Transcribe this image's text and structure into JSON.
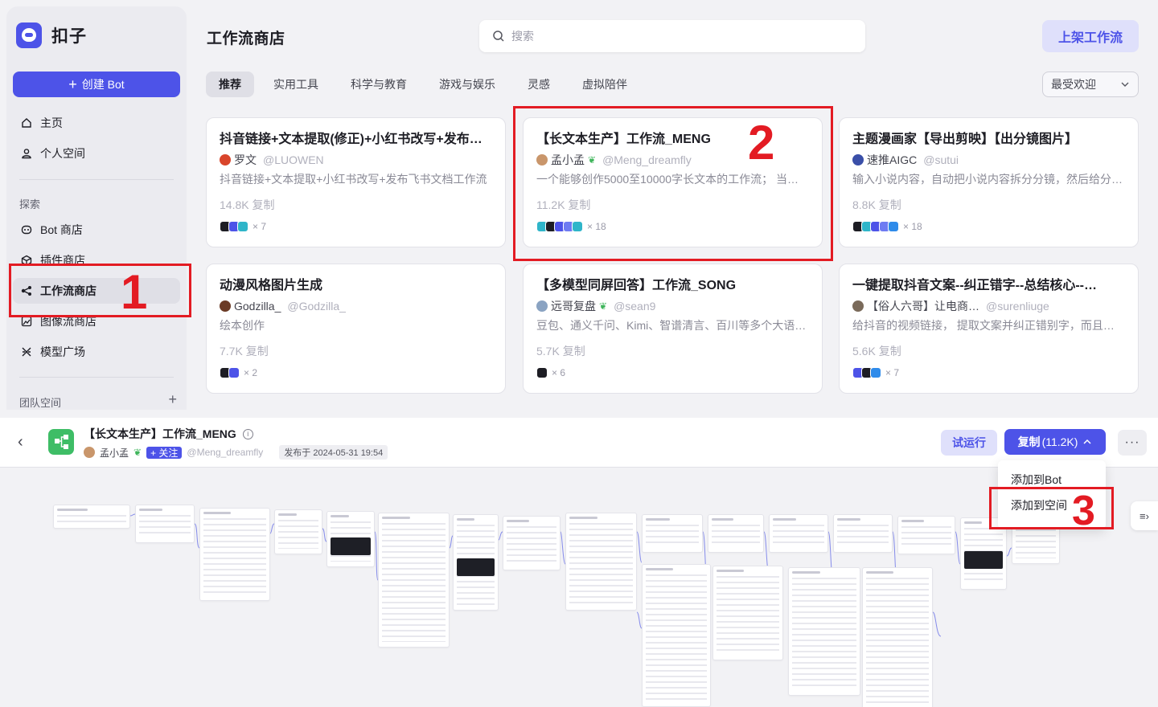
{
  "brand": {
    "name": "扣子"
  },
  "sidebar": {
    "create_label": "创建 Bot",
    "top_items": [
      {
        "label": "主页",
        "icon": "home-icon"
      },
      {
        "label": "个人空间",
        "icon": "user-icon"
      }
    ],
    "explore_title": "探索",
    "explore_items": [
      {
        "label": "Bot 商店",
        "icon": "bot-icon"
      },
      {
        "label": "插件商店",
        "icon": "cube-icon"
      },
      {
        "label": "工作流商店",
        "icon": "workflow-icon",
        "active": true
      },
      {
        "label": "图像流商店",
        "icon": "image-flow-icon"
      },
      {
        "label": "模型广场",
        "icon": "model-icon"
      }
    ],
    "team_title": "团队空间"
  },
  "header": {
    "title": "工作流商店",
    "search_placeholder": "搜索",
    "publish_label": "上架工作流"
  },
  "tabs": [
    "推荐",
    "实用工具",
    "科学与教育",
    "游戏与娱乐",
    "灵感",
    "虚拟陪伴"
  ],
  "sort": {
    "selected": "最受欢迎"
  },
  "cards": [
    {
      "title": "抖音链接+文本提取(修正)+小红书改写+发布…",
      "author": "罗文",
      "handle": "@LUOWEN",
      "desc": "抖音链接+文本提取+小红书改写+发布飞书文档工作流",
      "copies": "14.8K 复制",
      "plugins": "× 7",
      "avatar_color": "#d9452b",
      "plugin_colors": [
        "#1d1d24",
        "#4d53e8",
        "#2fb5c9"
      ],
      "verified": false
    },
    {
      "title": "【长文本生产】工作流_MENG",
      "author": "孟小孟",
      "handle": "@Meng_dreamfly",
      "desc": "一个能够创作5000至10000字长文本的工作流；  当…",
      "copies": "11.2K 复制",
      "plugins": "× 18",
      "avatar_color": "#c9966b",
      "plugin_colors": [
        "#2fb5c9",
        "#1d1d24",
        "#4d53e8",
        "#6e7bf2",
        "#2fb5c9"
      ],
      "verified": true
    },
    {
      "title": "主题漫画家【导出剪映】【出分镜图片】",
      "author": "速推AIGC",
      "handle": "@sutui",
      "desc": "输入小说内容，自动把小说内容拆分分镜，然后给分…",
      "copies": "8.8K 复制",
      "plugins": "× 18",
      "avatar_color": "#3a4fa8",
      "plugin_colors": [
        "#1d1d24",
        "#2fb5c9",
        "#4d53e8",
        "#6e7bf2",
        "#2f8bea"
      ],
      "verified": false
    },
    {
      "title": "动漫风格图片生成",
      "author": "Godzilla_",
      "handle": "@Godzilla_",
      "desc": "绘本创作",
      "copies": "7.7K 复制",
      "plugins": "× 2",
      "avatar_color": "#6b3b26",
      "plugin_colors": [
        "#1d1d24",
        "#4d53e8"
      ],
      "verified": false
    },
    {
      "title": "【多模型同屏回答】工作流_SONG",
      "author": "远哥复盘",
      "handle": "@sean9",
      "desc": "豆包、通义千问、Kimi、智谱清言、百川等多个大语…",
      "copies": "5.7K 复制",
      "plugins": "× 6",
      "avatar_color": "#8aa3c2",
      "plugin_colors": [
        "#1d1d24"
      ],
      "verified": true
    },
    {
      "title": "一键提取抖音文案--纠正错字--总结核心--…",
      "author": "【俗人六哥】让电商…",
      "handle": "@surenliuge",
      "desc": "给抖音的视频链接， 提取文案并纠正错别字，而且…",
      "copies": "5.6K 复制",
      "plugins": "× 7",
      "avatar_color": "#7a6a5a",
      "plugin_colors": [
        "#4d53e8",
        "#1d1d24",
        "#2f8bea"
      ],
      "verified": false
    }
  ],
  "detail": {
    "title": "【长文本生产】工作流_MENG",
    "author": "孟小孟",
    "follow_label": "+ 关注",
    "handle": "@Meng_dreamfly",
    "published": "发布于 2024-05-31 19:54",
    "trial_label": "试运行",
    "copy_label": "复制",
    "copy_count": "(11.2K)",
    "more_label": "···",
    "menu": [
      "添加到Bot",
      "添加到空间"
    ]
  },
  "annotations": [
    "1",
    "2",
    "3"
  ],
  "colors": {
    "accent": "#4d53e8",
    "annotation": "#e31b23",
    "workflow_icon": "#3ebd66"
  }
}
